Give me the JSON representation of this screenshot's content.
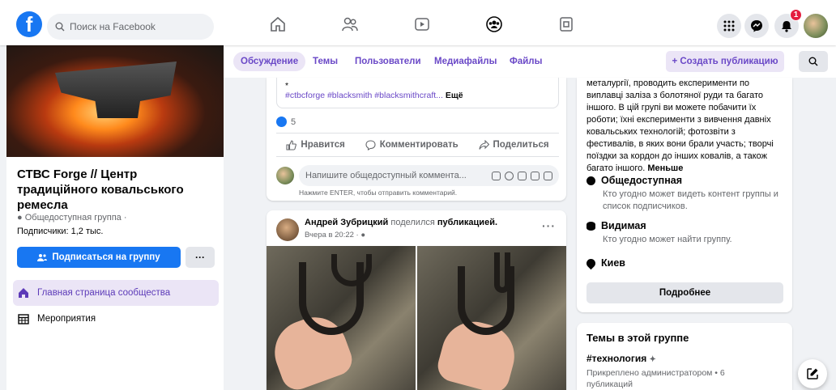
{
  "topbar": {
    "search_placeholder": "Поиск на Facebook",
    "notifications_count": "1",
    "brand_color": "#1877f2"
  },
  "group": {
    "title": "СТВС Forge // Центр традиційного ковальського ремесла",
    "privacy": "Общедоступная группа ·",
    "subscribers": "Подписчики: 1,2 тыс.",
    "subscribe_label": "Подписаться на группу",
    "more_label": "···"
  },
  "left_menu": {
    "items": [
      {
        "label": "Главная страница сообщества"
      },
      {
        "label": "Мероприятия"
      }
    ]
  },
  "tabs": {
    "items": [
      {
        "label": "Обсуждение"
      },
      {
        "label": "Темы"
      },
      {
        "label": "Пользователи"
      },
      {
        "label": "Медиафайлы"
      },
      {
        "label": "Файлы"
      }
    ],
    "create_label": "+ Создать публикацию"
  },
  "post1": {
    "bullet": "*",
    "hashtags": "#ctbcforge #blacksmith #blacksmithcraft...",
    "more": "Ещё",
    "like_count": "5",
    "like": "Нравится",
    "comment": "Комментировать",
    "share": "Поделиться",
    "comment_placeholder": "Напишите общедоступный коммента...",
    "enter_hint": "Нажмите ENTER, чтобы отправить комментарий."
  },
  "post2": {
    "author": "Андрей Зубрицкий",
    "shared_text": "поделился",
    "shared_object": "публикацией.",
    "time": "Вчера в 20:22 ·",
    "more": "···"
  },
  "about": {
    "description": "металургії, проводить експерименти по виплавці заліза з болотяної руди та багато іншого. В цій групі ви можете побачити їх роботи; їхні експерименти з вивчення давніх ковальських технологій; фотозвіти з фестивалів, в яких вони брали участь; творчі поїздки за кордон до інших ковалів, а також багато іншого.",
    "less": "Меньше",
    "public_title": "Общедоступная",
    "public_desc": "Кто угодно может видеть контент группы и список подписчиков.",
    "visible_title": "Видимая",
    "visible_desc": "Кто угодно может найти группу.",
    "location": "Киев",
    "details_label": "Подробнее"
  },
  "topics": {
    "title": "Темы в этой группе",
    "tag": "#технология",
    "pinned": "Прикреплено администратором • 6 публикаций"
  }
}
